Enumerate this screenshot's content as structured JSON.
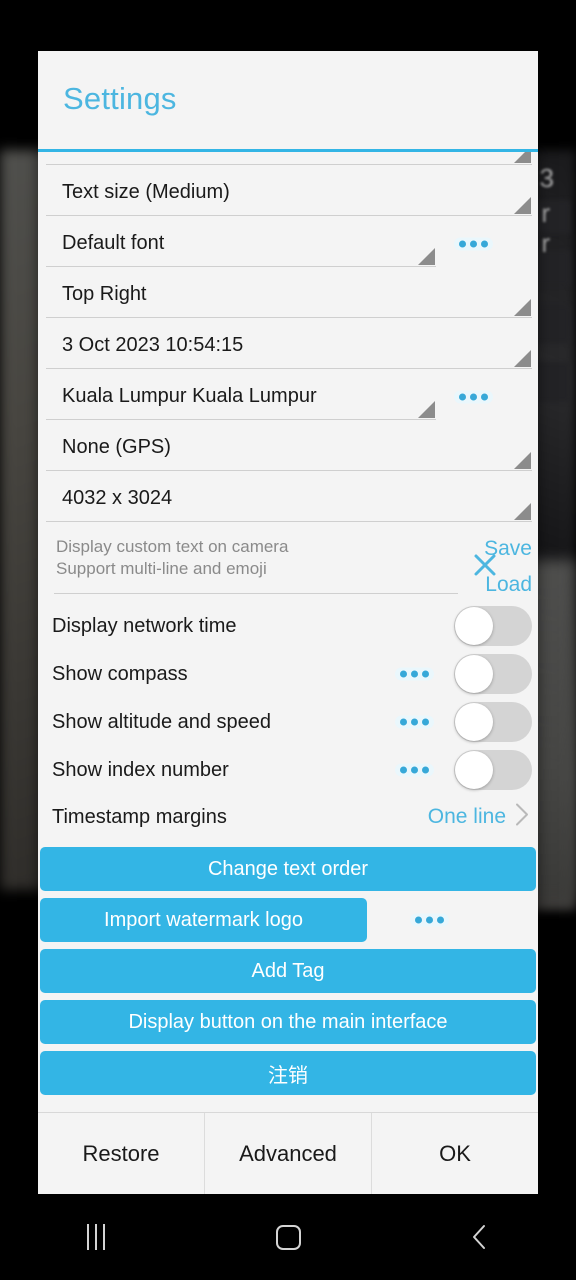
{
  "dialog": {
    "title": "Settings",
    "accent_color": "#33b5e5",
    "title_color": "#4cb6e0"
  },
  "spinner_rows": [
    {
      "label": "",
      "clipped": true,
      "width": "wide",
      "has_menu": false,
      "name": "spinner-row-clipped"
    },
    {
      "label": "Text size (Medium)",
      "clipped": false,
      "width": "wide",
      "has_menu": false,
      "name": "spinner-row-text-size"
    },
    {
      "label": "Default font",
      "clipped": false,
      "width": "narrow",
      "has_menu": true,
      "name": "spinner-row-font"
    },
    {
      "label": "Top Right",
      "clipped": false,
      "width": "wide",
      "has_menu": false,
      "name": "spinner-row-position"
    },
    {
      "label": "3 Oct 2023 10:54:15",
      "clipped": false,
      "width": "wide",
      "has_menu": false,
      "name": "spinner-row-datetime"
    },
    {
      "label": "Kuala Lumpur Kuala Lumpur",
      "clipped": false,
      "width": "narrow",
      "has_menu": true,
      "name": "spinner-row-location"
    },
    {
      "label": "None (GPS)",
      "clipped": false,
      "width": "wide",
      "has_menu": false,
      "name": "spinner-row-gps"
    },
    {
      "label": "4032 x 3024",
      "clipped": false,
      "width": "wide",
      "has_menu": false,
      "name": "spinner-row-resolution"
    }
  ],
  "custom_text": {
    "value": "",
    "placeholder": "Display custom text on camera\nSupport multi-line and emoji",
    "clear_icon": "close-x-icon",
    "save_label": "Save",
    "load_label": "Load"
  },
  "toggle_rows": [
    {
      "label": "Display network time",
      "checked": false,
      "has_menu": false,
      "name": "toggle-row-network-time"
    },
    {
      "label": "Show compass",
      "checked": false,
      "has_menu": true,
      "name": "toggle-row-compass"
    },
    {
      "label": "Show altitude and speed",
      "checked": false,
      "has_menu": true,
      "name": "toggle-row-altitude-speed"
    },
    {
      "label": "Show index number",
      "checked": false,
      "has_menu": true,
      "name": "toggle-row-index-number"
    }
  ],
  "margins_row": {
    "label": "Timestamp margins",
    "value": "One line",
    "chevron_icon": "chevron-right-icon"
  },
  "action_buttons": [
    {
      "label": "Change text order",
      "partial": false,
      "has_menu": false,
      "name": "button-change-text-order"
    },
    {
      "label": "Import watermark logo",
      "partial": true,
      "has_menu": true,
      "name": "button-import-watermark-logo"
    },
    {
      "label": "Add Tag",
      "partial": false,
      "has_menu": false,
      "name": "button-add-tag"
    },
    {
      "label": "Display button on the main interface",
      "partial": false,
      "has_menu": false,
      "name": "button-display-on-main-interface"
    },
    {
      "label": "注销",
      "partial": false,
      "has_menu": false,
      "name": "button-logout"
    }
  ],
  "footer_buttons": [
    {
      "label": "Restore",
      "name": "footer-button-restore"
    },
    {
      "label": "Advanced",
      "name": "footer-button-advanced"
    },
    {
      "label": "OK",
      "name": "footer-button-ok"
    }
  ],
  "navbar": {
    "recents": "recents-icon",
    "home": "home-icon",
    "back": "back-icon"
  },
  "background": {
    "ghost_text_1": "3",
    "ghost_text_2": "r",
    "ghost_text_3": "r"
  }
}
